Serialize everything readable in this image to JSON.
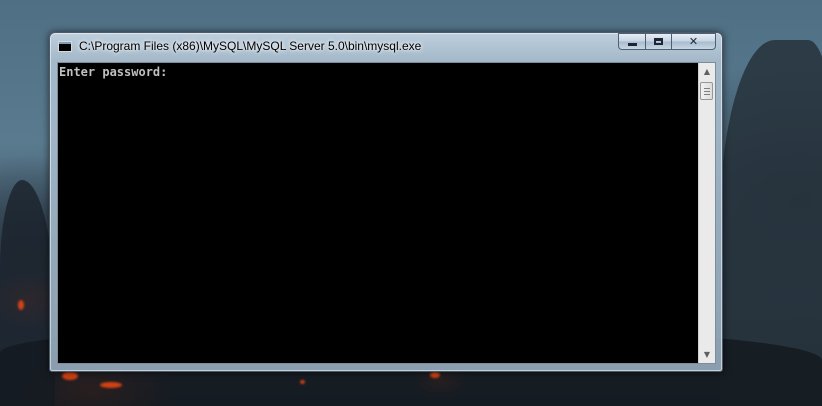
{
  "window": {
    "title": "C:\\Program Files (x86)\\MySQL\\MySQL Server 5.0\\bin\\mysql.exe",
    "icon": "console-window-icon"
  },
  "caption_buttons": {
    "minimize": "minimize-icon",
    "maximize": "maximize-icon",
    "close": "✕"
  },
  "console": {
    "output": "Enter password:",
    "colors": {
      "background": "#000000",
      "text": "#c0c0c0"
    }
  },
  "scrollbar": {
    "up_arrow": "▲",
    "down_arrow": "▼"
  }
}
